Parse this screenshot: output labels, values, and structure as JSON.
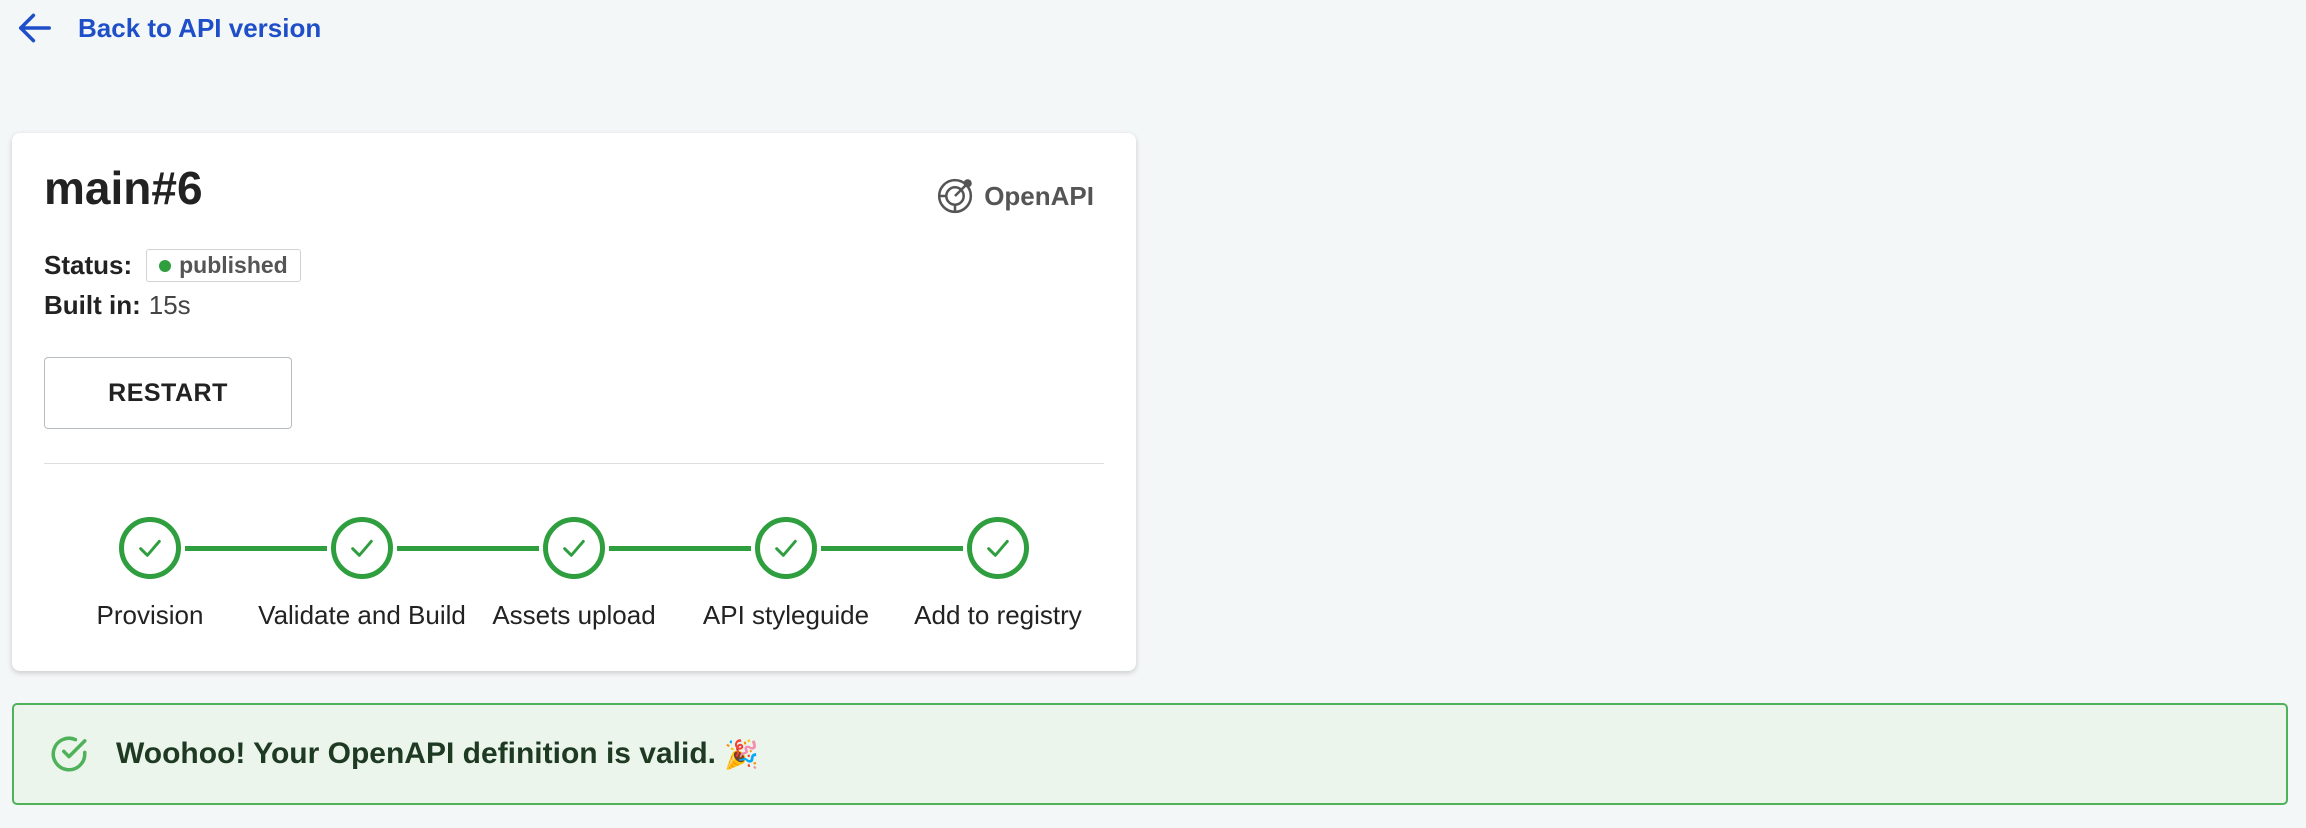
{
  "nav": {
    "back_label": "Back to API version",
    "back_icon": "arrow-left-icon"
  },
  "card": {
    "title": "main#6",
    "type_label": "OpenAPI",
    "type_icon": "openapi-logo-icon",
    "status_label": "Status:",
    "status_value": "published",
    "status_color": "#2e9e3e",
    "built_label": "Built in:",
    "built_value": "15s",
    "restart_label": "RESTART"
  },
  "steps": [
    {
      "label": "Provision",
      "state": "done"
    },
    {
      "label": "Validate and Build",
      "state": "done"
    },
    {
      "label": "Assets upload",
      "state": "done"
    },
    {
      "label": "API styleguide",
      "state": "done"
    },
    {
      "label": "Add to registry",
      "state": "done"
    }
  ],
  "banner": {
    "text": "Woohoo! Your OpenAPI definition is valid.",
    "emoji": "🎉",
    "icon": "check-circle-icon"
  },
  "colors": {
    "accent": "#1f4fc8",
    "success": "#2e9e3e",
    "success_bg": "#ebf5ec"
  }
}
